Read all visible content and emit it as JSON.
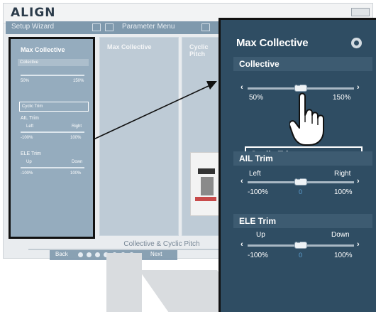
{
  "window": {
    "logo": "ALIGN"
  },
  "menubar": {
    "tab1": "Setup Wizard",
    "tab2": "Parameter Menu"
  },
  "bg_panels": {
    "panel2_title": "Max Collective",
    "panel3_title": "Cyclic Pitch"
  },
  "left_panel": {
    "title": "Max Collective",
    "collective": "Collective",
    "col_min": "50%",
    "col_max": "150%",
    "cyclic_trim": "Cyclic Trim",
    "ail_trim": "AIL Trim",
    "ail_left": "Left",
    "ail_right": "Right",
    "ail_min": "-100%",
    "ail_max": "100%",
    "ele_trim": "ELE Trim",
    "ele_up": "Up",
    "ele_down": "Down",
    "ele_min": "-100%",
    "ele_max": "100%"
  },
  "nav": {
    "title": "Collective & Cyclic Pitch",
    "back": "Back",
    "next": "Next",
    "dots": 7
  },
  "zoom": {
    "title": "Max Collective",
    "collective_header": "Collective",
    "collective_min": "50%",
    "collective_max": "150%",
    "cyclic_trim_button": "Cyclic Trim",
    "ail_header": "AIL Trim",
    "ail_left": "Left",
    "ail_right": "Right",
    "ail_min": "-100%",
    "ail_mid": "0",
    "ail_max": "100%",
    "ele_header": "ELE Trim",
    "ele_up": "Up",
    "ele_down": "Down",
    "ele_min": "-100%",
    "ele_mid": "0",
    "ele_max": "100%"
  },
  "icons": [
    "gear-icon",
    "chevron-left-icon",
    "chevron-right-icon",
    "pointing-hand-icon",
    "arrow-icon"
  ]
}
